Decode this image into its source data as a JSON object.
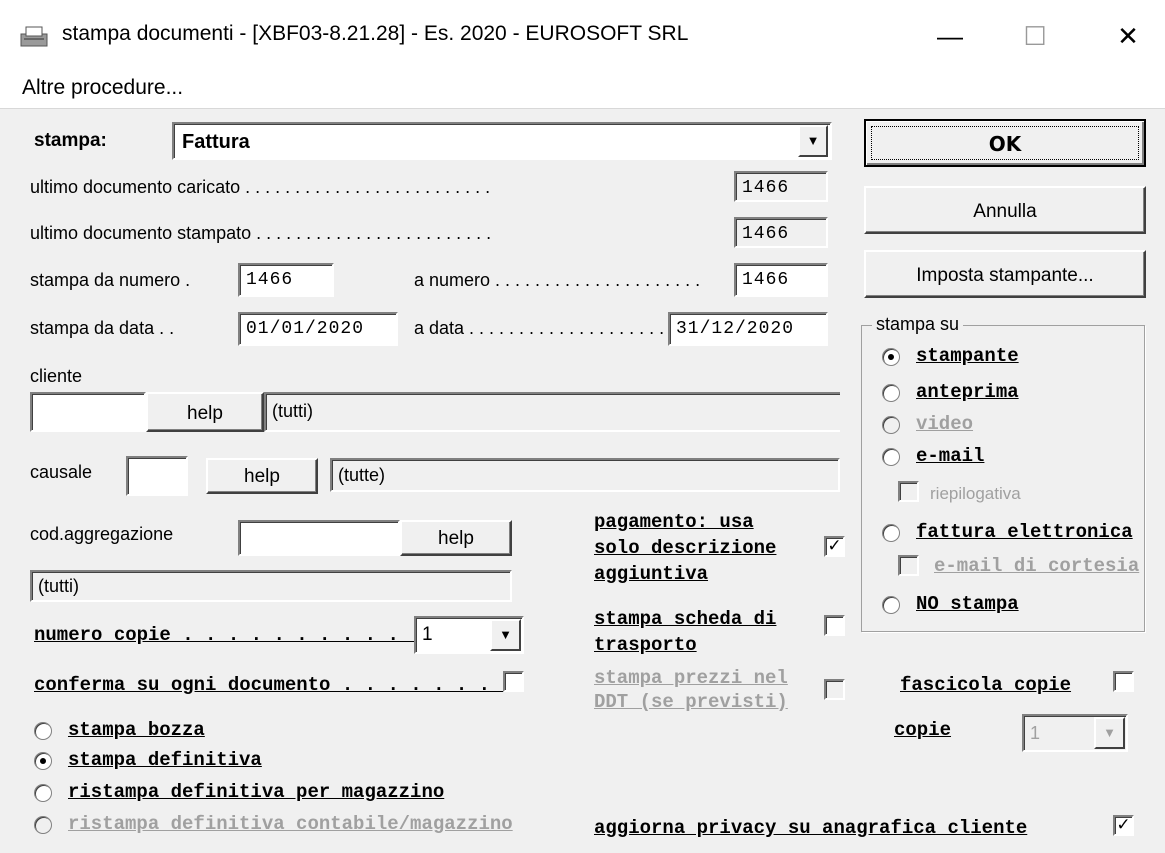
{
  "window": {
    "title": "stampa documenti - [XBF03-8.21.28] - Es. 2020 - EUROSOFT SRL",
    "minimize": "—",
    "maximize": "☐",
    "close": "✕"
  },
  "menu": {
    "altre": "Altre procedure..."
  },
  "form": {
    "stampa_label": "stampa:",
    "stampa_value": "Fattura",
    "ultimo_caricato_label": "ultimo documento caricato . . . . . . . . . . . . . . . . . . . . . . . . .",
    "ultimo_caricato_value": "1466",
    "ultimo_stampato_label": "ultimo documento stampato . . . . . . . . . . . . . . . . . . . . . . . .",
    "ultimo_stampato_value": "1466",
    "da_numero_label": "stampa da numero .",
    "da_numero_value": "1466",
    "a_numero_label": "a numero . . . . . . . . . . . . . . . . . . . . .",
    "a_numero_value": "1466",
    "da_data_label": "stampa da data . .",
    "da_data_value": "01/01/2020",
    "a_data_label": "a data . . . . . . . . . . . . . . . . . . . . . . .",
    "a_data_value": "31/12/2020",
    "cliente_label": "cliente",
    "cliente_value": "",
    "cliente_help": "help",
    "cliente_desc": "(tutti)",
    "causale_label": "causale",
    "causale_value": "",
    "causale_help": "help",
    "causale_desc": "(tutte)",
    "aggregazione_label": "cod.aggregazione",
    "aggregazione_value": "",
    "aggregazione_help": "help",
    "aggregazione_desc": "(tutti)",
    "numero_copie_label": "numero copie . . . . . . . . . . . . . .",
    "numero_copie_value": "1",
    "conferma_label": "conferma su ogni documento . . . . . . . .",
    "pagamento_label_1": "pagamento: usa",
    "pagamento_label_2": "solo descrizione",
    "pagamento_label_3": "aggiuntiva",
    "scheda_label_1": "stampa scheda di",
    "scheda_label_2": "trasporto",
    "prezzi_label_1": "stampa prezzi nel",
    "prezzi_label_2": "DDT (se previsti)",
    "fascicola_label": "fascicola copie",
    "copie_label": "copie",
    "copie_value": "1",
    "privacy_label": "aggiorna privacy su anagrafica cliente",
    "check_mark": "✓",
    "radios": {
      "bozza": "stampa bozza",
      "definitiva": "stampa definitiva",
      "ristampa_magazzino": "ristampa definitiva per magazzino",
      "ristampa_contabile": "ristampa definitiva contabile/magazzino"
    }
  },
  "buttons": {
    "ok": "OK",
    "annulla": "Annulla",
    "imposta": "Imposta stampante..."
  },
  "stampa_su": {
    "label": "stampa su",
    "stampante": "stampante",
    "anteprima": "anteprima",
    "video": "video",
    "email": "e-mail",
    "riepilogativa": "riepilogativa",
    "fattura_elettronica": "fattura elettronica",
    "email_cortesia": "e-mail di cortesia",
    "no_stampa": "NO stampa"
  },
  "icons": {
    "window": "printer-icon",
    "dropdown": "▼"
  }
}
